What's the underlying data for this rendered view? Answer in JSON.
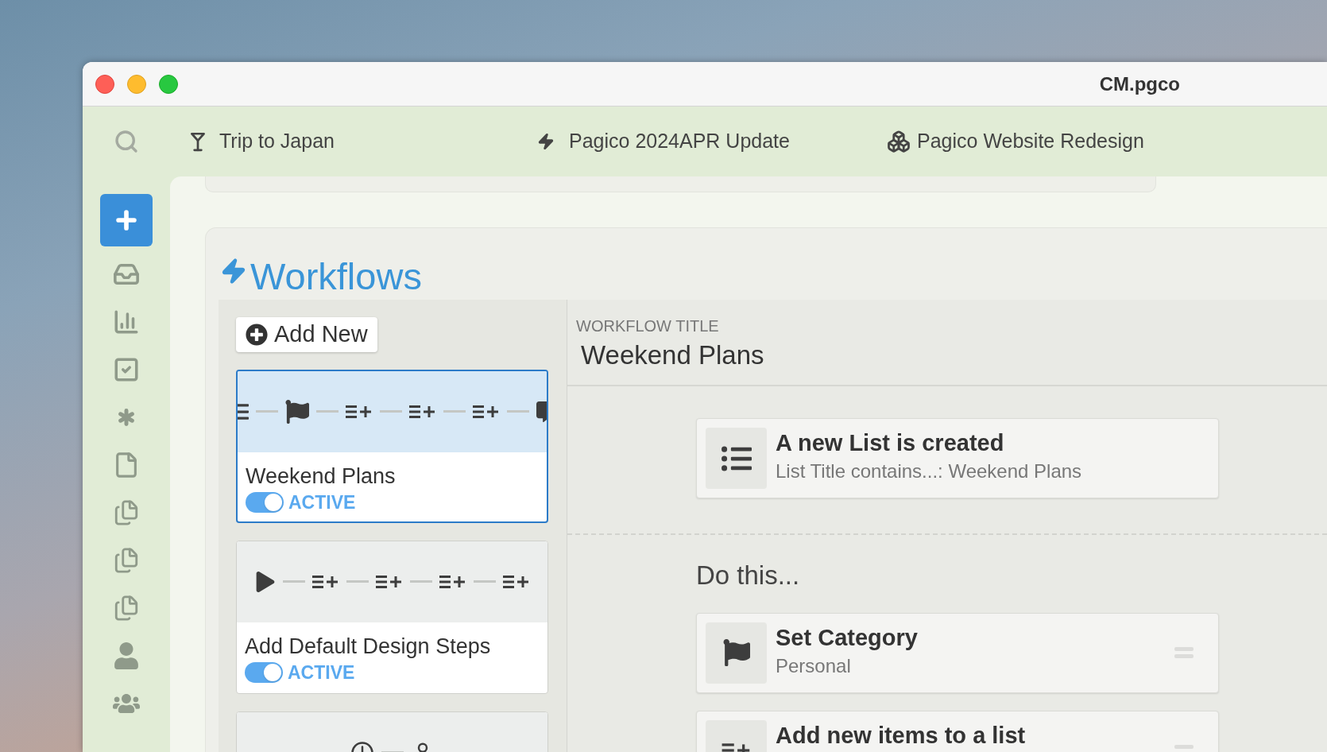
{
  "window": {
    "title": "CM.pgco"
  },
  "toolbar": {
    "items": [
      {
        "kind": "glass",
        "label": "Trip to Japan"
      },
      {
        "kind": "bolt",
        "label": "Pagico 2024APR Update"
      },
      {
        "kind": "boxes",
        "label": "Pagico Website Redesign"
      }
    ]
  },
  "section": {
    "title": "Workflows"
  },
  "add_button": "Add New",
  "workflows": [
    {
      "title": "Weekend Plans",
      "status": "ACTIVE",
      "on": true,
      "selected": true,
      "steps": [
        {
          "kind": "list"
        },
        {
          "kind": "flag"
        },
        {
          "kind": "add"
        },
        {
          "kind": "add"
        },
        {
          "kind": "add"
        },
        {
          "kind": "comment"
        }
      ]
    },
    {
      "title": "Add Default Design Steps",
      "status": "ACTIVE",
      "on": true,
      "selected": false,
      "steps": [
        {
          "kind": "play"
        },
        {
          "kind": "add"
        },
        {
          "kind": "add"
        },
        {
          "kind": "add"
        },
        {
          "kind": "add"
        }
      ]
    },
    {
      "selected": false,
      "steps": [
        {
          "kind": "clock"
        },
        {
          "kind": "person"
        }
      ]
    }
  ],
  "detail": {
    "label": "WORKFLOW TITLE",
    "title": "Weekend Plans",
    "trigger": {
      "kind": "list",
      "title": "A new List is created",
      "detail": "List Title contains...: Weekend Plans"
    },
    "action_heading": "Do this...",
    "actions": [
      {
        "kind": "flag",
        "title": "Set Category",
        "detail": "Personal"
      },
      {
        "kind": "add",
        "title": "Add new items to a list"
      }
    ]
  }
}
